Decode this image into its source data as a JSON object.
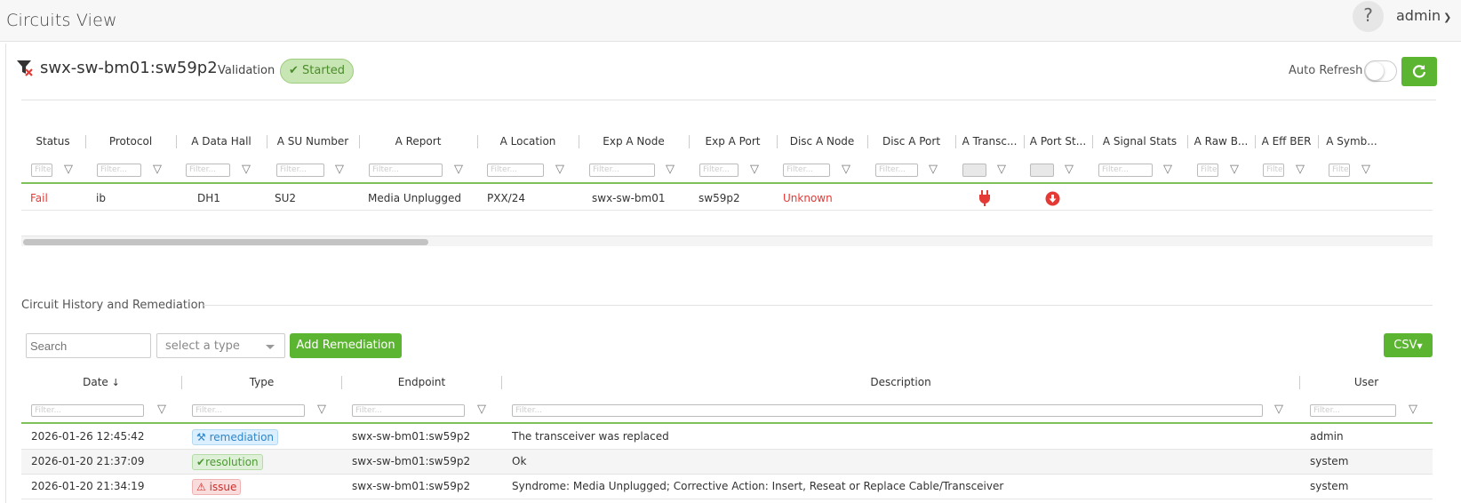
{
  "app": {
    "title": "Circuits View"
  },
  "header": {
    "help": "?",
    "user": "admin"
  },
  "circuit": {
    "id": "swx-sw-bm01:sw59p2",
    "validation_label": "Validation",
    "status": "Started"
  },
  "auto_refresh": {
    "label": "Auto Refresh",
    "enabled": false
  },
  "colors": {
    "accent": "#5cb531",
    "fail": "#e53935"
  },
  "grid": {
    "columns": [
      "Status",
      "Protocol",
      "A Data Hall",
      "A SU Number",
      "A Report",
      "A Location",
      "Exp A Node",
      "Exp A Port",
      "Disc A Node",
      "Disc A Port",
      "A Transc...",
      "A Port St...",
      "A Signal Stats",
      "A Raw B...",
      "A Eff BER",
      "A Symb..."
    ],
    "filter_placeholder": "Filter...",
    "row": {
      "status": "Fail",
      "protocol": "ib",
      "data_hall": "DH1",
      "su_number": "SU2",
      "report": "Media Unplugged",
      "location": "PXX/24",
      "exp_node": "swx-sw-bm01",
      "exp_port": "sw59p2",
      "disc_node": "Unknown",
      "disc_port": "",
      "transceiver_icon": "plug-icon",
      "port_state_icon": "down-arrow-icon"
    }
  },
  "history": {
    "title": "Circuit History and Remediation",
    "search_placeholder": "Search",
    "type_placeholder": "select a type",
    "add_button": "Add Remediation",
    "csv_button": "CSV",
    "columns": {
      "date": "Date",
      "type": "Type",
      "endpoint": "Endpoint",
      "description": "Description",
      "user": "User"
    },
    "filter_placeholder": "Filter...",
    "rows": [
      {
        "date": "2026-01-26 12:45:42",
        "type": "remediation",
        "endpoint": "swx-sw-bm01:sw59p2",
        "description": "The transceiver was replaced",
        "user": "admin"
      },
      {
        "date": "2026-01-20 21:37:09",
        "type": "resolution",
        "endpoint": "swx-sw-bm01:sw59p2",
        "description": "Ok",
        "user": "system"
      },
      {
        "date": "2026-01-20 21:34:19",
        "type": "issue",
        "endpoint": "swx-sw-bm01:sw59p2",
        "description": "Syndrome: Media Unplugged; Corrective Action: Insert, Reseat or Replace Cable/Transceiver",
        "user": "system"
      }
    ]
  }
}
